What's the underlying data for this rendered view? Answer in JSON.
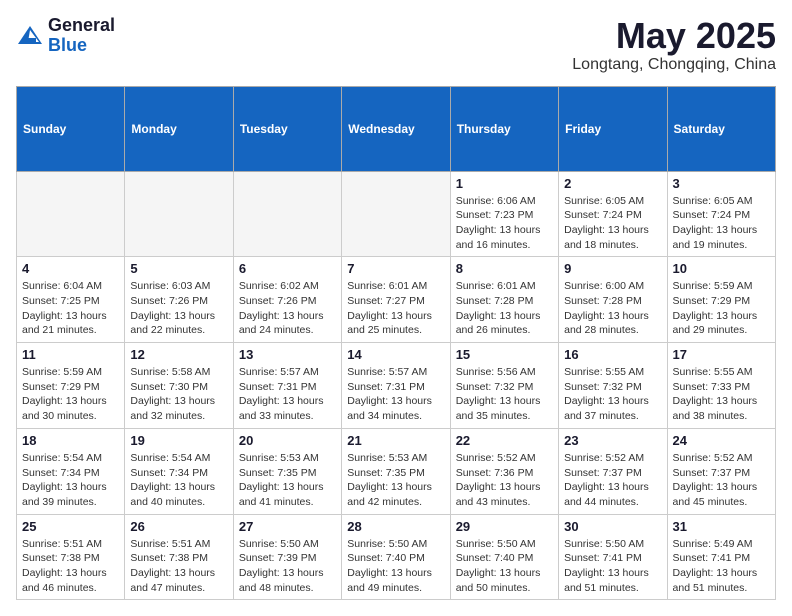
{
  "header": {
    "logo_general": "General",
    "logo_blue": "Blue",
    "month_title": "May 2025",
    "location": "Longtang, Chongqing, China"
  },
  "weekdays": [
    "Sunday",
    "Monday",
    "Tuesday",
    "Wednesday",
    "Thursday",
    "Friday",
    "Saturday"
  ],
  "weeks": [
    [
      {
        "day": "",
        "info": ""
      },
      {
        "day": "",
        "info": ""
      },
      {
        "day": "",
        "info": ""
      },
      {
        "day": "",
        "info": ""
      },
      {
        "day": "1",
        "info": "Sunrise: 6:06 AM\nSunset: 7:23 PM\nDaylight: 13 hours\nand 16 minutes."
      },
      {
        "day": "2",
        "info": "Sunrise: 6:05 AM\nSunset: 7:24 PM\nDaylight: 13 hours\nand 18 minutes."
      },
      {
        "day": "3",
        "info": "Sunrise: 6:05 AM\nSunset: 7:24 PM\nDaylight: 13 hours\nand 19 minutes."
      }
    ],
    [
      {
        "day": "4",
        "info": "Sunrise: 6:04 AM\nSunset: 7:25 PM\nDaylight: 13 hours\nand 21 minutes."
      },
      {
        "day": "5",
        "info": "Sunrise: 6:03 AM\nSunset: 7:26 PM\nDaylight: 13 hours\nand 22 minutes."
      },
      {
        "day": "6",
        "info": "Sunrise: 6:02 AM\nSunset: 7:26 PM\nDaylight: 13 hours\nand 24 minutes."
      },
      {
        "day": "7",
        "info": "Sunrise: 6:01 AM\nSunset: 7:27 PM\nDaylight: 13 hours\nand 25 minutes."
      },
      {
        "day": "8",
        "info": "Sunrise: 6:01 AM\nSunset: 7:28 PM\nDaylight: 13 hours\nand 26 minutes."
      },
      {
        "day": "9",
        "info": "Sunrise: 6:00 AM\nSunset: 7:28 PM\nDaylight: 13 hours\nand 28 minutes."
      },
      {
        "day": "10",
        "info": "Sunrise: 5:59 AM\nSunset: 7:29 PM\nDaylight: 13 hours\nand 29 minutes."
      }
    ],
    [
      {
        "day": "11",
        "info": "Sunrise: 5:59 AM\nSunset: 7:29 PM\nDaylight: 13 hours\nand 30 minutes."
      },
      {
        "day": "12",
        "info": "Sunrise: 5:58 AM\nSunset: 7:30 PM\nDaylight: 13 hours\nand 32 minutes."
      },
      {
        "day": "13",
        "info": "Sunrise: 5:57 AM\nSunset: 7:31 PM\nDaylight: 13 hours\nand 33 minutes."
      },
      {
        "day": "14",
        "info": "Sunrise: 5:57 AM\nSunset: 7:31 PM\nDaylight: 13 hours\nand 34 minutes."
      },
      {
        "day": "15",
        "info": "Sunrise: 5:56 AM\nSunset: 7:32 PM\nDaylight: 13 hours\nand 35 minutes."
      },
      {
        "day": "16",
        "info": "Sunrise: 5:55 AM\nSunset: 7:32 PM\nDaylight: 13 hours\nand 37 minutes."
      },
      {
        "day": "17",
        "info": "Sunrise: 5:55 AM\nSunset: 7:33 PM\nDaylight: 13 hours\nand 38 minutes."
      }
    ],
    [
      {
        "day": "18",
        "info": "Sunrise: 5:54 AM\nSunset: 7:34 PM\nDaylight: 13 hours\nand 39 minutes."
      },
      {
        "day": "19",
        "info": "Sunrise: 5:54 AM\nSunset: 7:34 PM\nDaylight: 13 hours\nand 40 minutes."
      },
      {
        "day": "20",
        "info": "Sunrise: 5:53 AM\nSunset: 7:35 PM\nDaylight: 13 hours\nand 41 minutes."
      },
      {
        "day": "21",
        "info": "Sunrise: 5:53 AM\nSunset: 7:35 PM\nDaylight: 13 hours\nand 42 minutes."
      },
      {
        "day": "22",
        "info": "Sunrise: 5:52 AM\nSunset: 7:36 PM\nDaylight: 13 hours\nand 43 minutes."
      },
      {
        "day": "23",
        "info": "Sunrise: 5:52 AM\nSunset: 7:37 PM\nDaylight: 13 hours\nand 44 minutes."
      },
      {
        "day": "24",
        "info": "Sunrise: 5:52 AM\nSunset: 7:37 PM\nDaylight: 13 hours\nand 45 minutes."
      }
    ],
    [
      {
        "day": "25",
        "info": "Sunrise: 5:51 AM\nSunset: 7:38 PM\nDaylight: 13 hours\nand 46 minutes."
      },
      {
        "day": "26",
        "info": "Sunrise: 5:51 AM\nSunset: 7:38 PM\nDaylight: 13 hours\nand 47 minutes."
      },
      {
        "day": "27",
        "info": "Sunrise: 5:50 AM\nSunset: 7:39 PM\nDaylight: 13 hours\nand 48 minutes."
      },
      {
        "day": "28",
        "info": "Sunrise: 5:50 AM\nSunset: 7:40 PM\nDaylight: 13 hours\nand 49 minutes."
      },
      {
        "day": "29",
        "info": "Sunrise: 5:50 AM\nSunset: 7:40 PM\nDaylight: 13 hours\nand 50 minutes."
      },
      {
        "day": "30",
        "info": "Sunrise: 5:50 AM\nSunset: 7:41 PM\nDaylight: 13 hours\nand 51 minutes."
      },
      {
        "day": "31",
        "info": "Sunrise: 5:49 AM\nSunset: 7:41 PM\nDaylight: 13 hours\nand 51 minutes."
      }
    ]
  ]
}
